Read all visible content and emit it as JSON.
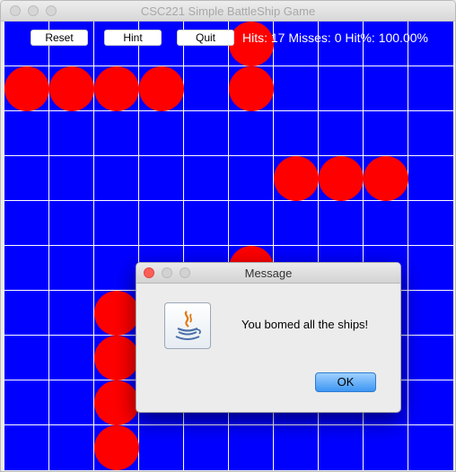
{
  "window": {
    "title": "CSC221 Simple BattleShip Game"
  },
  "toolbar": {
    "reset_label": "Reset",
    "hint_label": "Hint",
    "quit_label": "Quit"
  },
  "stats": {
    "text": "Hits: 17 Misses: 0 Hit%: 100.00%"
  },
  "board": {
    "rows": 10,
    "cols": 10,
    "background_color": "#0000ff",
    "grid_color": "#ffffff",
    "hit_color": "#ff0000",
    "hits": [
      {
        "row": 0,
        "col": 5
      },
      {
        "row": 1,
        "col": 0
      },
      {
        "row": 1,
        "col": 1
      },
      {
        "row": 1,
        "col": 2
      },
      {
        "row": 1,
        "col": 3
      },
      {
        "row": 1,
        "col": 5
      },
      {
        "row": 3,
        "col": 6
      },
      {
        "row": 3,
        "col": 7
      },
      {
        "row": 3,
        "col": 8
      },
      {
        "row": 5,
        "col": 5
      },
      {
        "row": 6,
        "col": 2
      },
      {
        "row": 7,
        "col": 2
      },
      {
        "row": 8,
        "col": 2
      },
      {
        "row": 9,
        "col": 2
      }
    ]
  },
  "dialog": {
    "title": "Message",
    "message": "You bomed all the ships!",
    "ok_label": "OK",
    "icon": "java-coffee-cup-icon"
  }
}
